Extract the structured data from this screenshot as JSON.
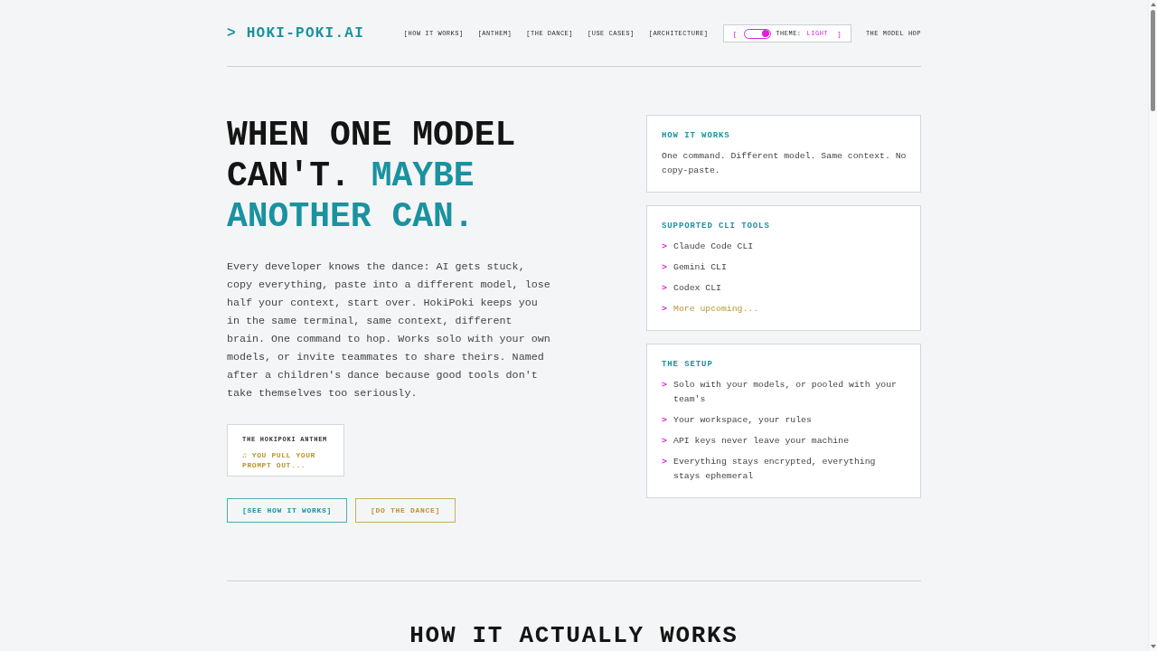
{
  "header": {
    "logo": "> HOKI-POKI.AI",
    "nav": [
      "[HOW IT WORKS]",
      "[ANTHEM]",
      "[THE DANCE]",
      "[USE CASES]",
      "[ARCHITECTURE]"
    ],
    "theme_toggle": {
      "open_bracket": "[",
      "label": "THEME:",
      "value": "LIGHT",
      "close_bracket": "]",
      "on": true
    },
    "end_link": "THE MODEL HOP"
  },
  "hero": {
    "heading": [
      {
        "text": "WHEN ONE MODEL CAN'T.",
        "accent": false
      },
      {
        "text": "MAYBE ANOTHER CAN.",
        "accent": true
      }
    ],
    "description": "Every developer knows the dance: AI gets stuck, copy everything, paste into a different model, lose half your context, start over. HokiPoki keeps you in the same terminal, same context, different brain. One command to hop. Works solo with your own models, or invite teammates to share theirs. Named after a children's dance because good tools don't take themselves too seriously.",
    "anthem": {
      "title": "THE HOKIPOKI ANTHEM",
      "lyric": "♫ YOU PULL YOUR PROMPT OUT..."
    },
    "buttons": [
      {
        "label": "[SEE HOW IT WORKS]",
        "kind": "primary"
      },
      {
        "label": "[DO THE DANCE]",
        "kind": "secondary"
      }
    ]
  },
  "cards": [
    {
      "kind": "text",
      "title": "HOW IT WORKS",
      "body": "One command. Different model. Same context. No copy-paste."
    },
    {
      "kind": "list",
      "title": "SUPPORTED CLI TOOLS",
      "items": [
        {
          "marker": ">",
          "text": "Claude Code CLI",
          "kind": "tool"
        },
        {
          "marker": ">",
          "text": "Gemini CLI",
          "kind": "tool"
        },
        {
          "marker": ">",
          "text": "Codex CLI",
          "kind": "tool"
        },
        {
          "marker": ">",
          "text": "More upcoming...",
          "kind": "upcoming"
        }
      ]
    },
    {
      "kind": "list",
      "title": "THE SETUP",
      "items": [
        {
          "marker": ">",
          "text": "Solo with your models, or pooled with your team's",
          "kind": "point"
        },
        {
          "marker": ">",
          "text": "Your workspace, your rules",
          "kind": "point"
        },
        {
          "marker": ">",
          "text": "API keys never leave your machine",
          "kind": "point"
        },
        {
          "marker": ">",
          "text": "Everything stays encrypted, everything stays ephemeral",
          "kind": "point"
        }
      ]
    }
  ],
  "next_section": {
    "title": "HOW IT ACTUALLY WORKS"
  }
}
